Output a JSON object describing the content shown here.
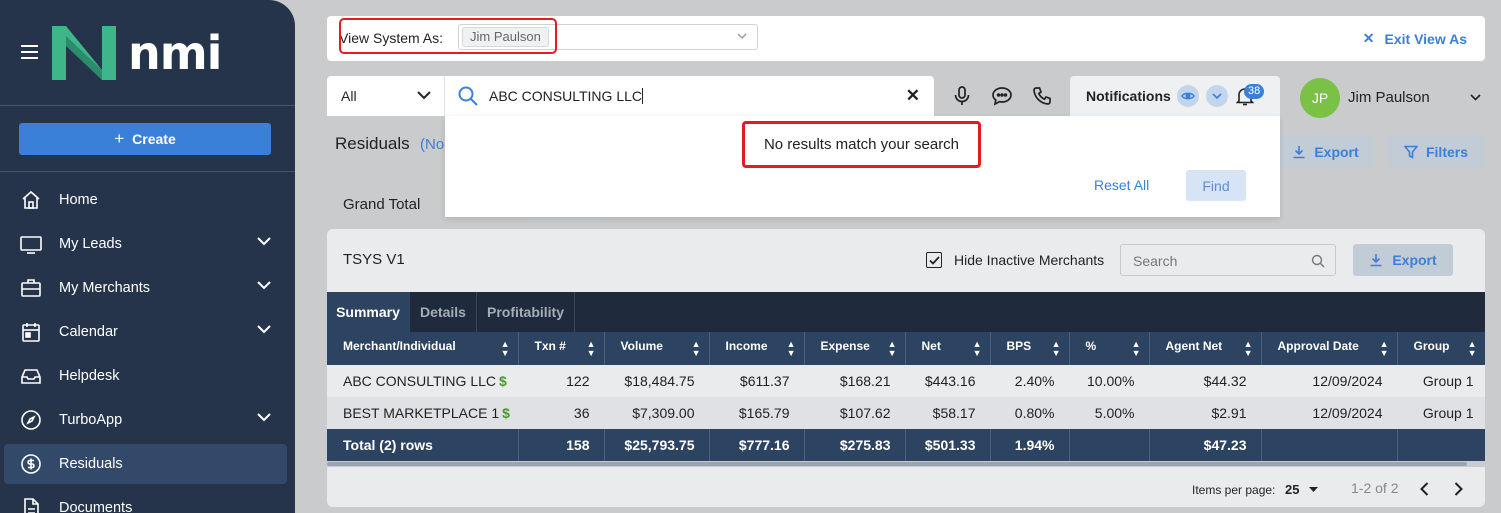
{
  "sidebar": {
    "logo_text": "nmi",
    "create_label": "Create",
    "items": [
      {
        "label": "Home",
        "icon": "home-icon",
        "has_chevron": false
      },
      {
        "label": "My Leads",
        "icon": "monitor-icon",
        "has_chevron": true
      },
      {
        "label": "My Merchants",
        "icon": "briefcase-icon",
        "has_chevron": true
      },
      {
        "label": "Calendar",
        "icon": "calendar-icon",
        "has_chevron": true
      },
      {
        "label": "Helpdesk",
        "icon": "inbox-icon",
        "has_chevron": false
      },
      {
        "label": "TurboApp",
        "icon": "compass-icon",
        "has_chevron": true
      },
      {
        "label": "Residuals",
        "icon": "dollar-circle-icon",
        "has_chevron": false,
        "active": true
      },
      {
        "label": "Documents",
        "icon": "document-icon",
        "has_chevron": false
      }
    ]
  },
  "view_as": {
    "label": "View System As:",
    "selected": "Jim Paulson",
    "exit_label": "Exit View As"
  },
  "search": {
    "category": "All",
    "query": "ABC CONSULTING LLC",
    "no_results": "No results match your search",
    "reset_label": "Reset All",
    "find_label": "Find"
  },
  "notifications": {
    "label": "Notifications",
    "count": "38"
  },
  "user": {
    "initials": "JP",
    "name": "Jim Paulson"
  },
  "page": {
    "title": "Residuals",
    "subtitle_partial": "(No",
    "export_label": "Export",
    "filters_label": "Filters",
    "grand_total_label": "Grand Total"
  },
  "card": {
    "title": "TSYS V1",
    "hide_inactive_label": "Hide Inactive Merchants",
    "hide_inactive_checked": true,
    "search_placeholder": "Search",
    "export_label": "Export",
    "tabs": [
      "Summary",
      "Details",
      "Profitability"
    ],
    "active_tab": "Summary",
    "columns": [
      "Merchant/Individual",
      "Txn #",
      "Volume",
      "Income",
      "Expense",
      "Net",
      "BPS",
      "%",
      "Agent Net",
      "Approval Date",
      "Group"
    ],
    "rows": [
      {
        "merchant": "ABC CONSULTING LLC",
        "txn": "122",
        "volume": "$18,484.75",
        "income": "$611.37",
        "expense": "$168.21",
        "net": "$443.16",
        "bps": "2.40%",
        "pct": "10.00%",
        "agent_net": "$44.32",
        "approval_date": "12/09/2024",
        "group": "Group 1"
      },
      {
        "merchant": "BEST MARKETPLACE 1",
        "txn": "36",
        "volume": "$7,309.00",
        "income": "$165.79",
        "expense": "$107.62",
        "net": "$58.17",
        "bps": "0.80%",
        "pct": "5.00%",
        "agent_net": "$2.91",
        "approval_date": "12/09/2024",
        "group": "Group 1"
      }
    ],
    "total": {
      "label": "Total (2) rows",
      "txn": "158",
      "volume": "$25,793.75",
      "income": "$777.16",
      "expense": "$275.83",
      "net": "$501.33",
      "bps": "1.94%",
      "pct": "",
      "agent_net": "$47.23",
      "approval_date": "",
      "group": ""
    },
    "pager": {
      "items_per_page_label": "Items per page:",
      "items_per_page": "25",
      "range": "1-2 of 2"
    }
  },
  "colors": {
    "sidebar_bg": "#25344a",
    "accent": "#3a7fd8",
    "highlight_red": "#e31b23",
    "table_header": "#2c4361",
    "avatar_green": "#7bc146"
  }
}
